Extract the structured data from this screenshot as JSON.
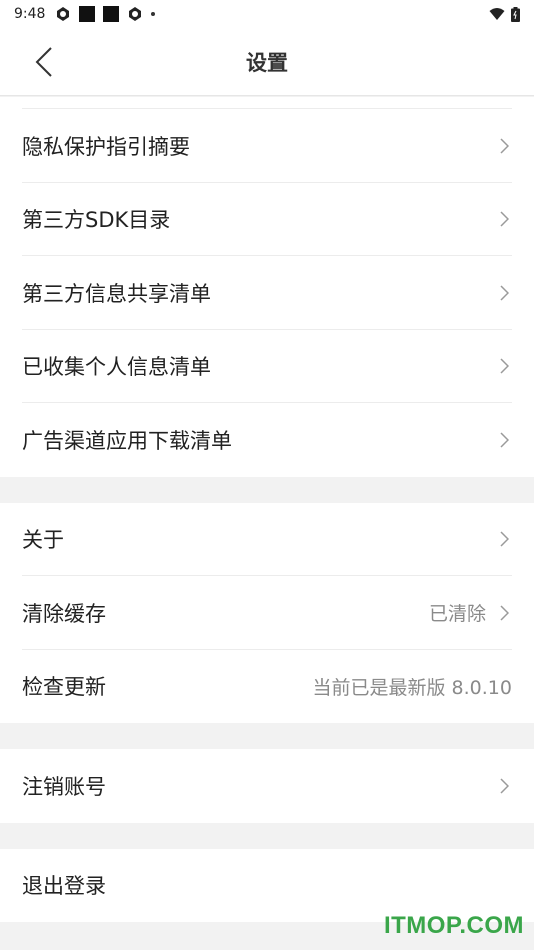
{
  "status_bar": {
    "time": "9:48",
    "icons": [
      "app-notification-icon",
      "app-square-icon",
      "app-square-icon",
      "app-notification-icon",
      "dot-icon",
      "wifi-icon",
      "battery-icon"
    ]
  },
  "header": {
    "title": "设置",
    "back_icon": "chevron-left-icon"
  },
  "groups": [
    {
      "items": [
        {
          "label": "隐私保护指引摘要",
          "chevron": true
        },
        {
          "label": "第三方SDK目录",
          "chevron": true
        },
        {
          "label": "第三方信息共享清单",
          "chevron": true
        },
        {
          "label": "已收集个人信息清单",
          "chevron": true
        },
        {
          "label": "广告渠道应用下载清单",
          "chevron": true
        }
      ]
    },
    {
      "items": [
        {
          "label": "关于",
          "chevron": true
        },
        {
          "label": "清除缓存",
          "value": "已清除",
          "chevron": true
        },
        {
          "label": "检查更新",
          "value": "当前已是最新版 8.0.10",
          "chevron": false
        }
      ]
    },
    {
      "items": [
        {
          "label": "注销账号",
          "chevron": true
        }
      ]
    },
    {
      "items": [
        {
          "label": "退出登录",
          "chevron": false
        }
      ]
    }
  ],
  "watermark": "ITMOP.COM",
  "colors": {
    "background": "#f2f2f2",
    "card": "#ffffff",
    "text": "#222222",
    "secondary_text": "#8a8a8a",
    "watermark": "#3aa64a"
  }
}
